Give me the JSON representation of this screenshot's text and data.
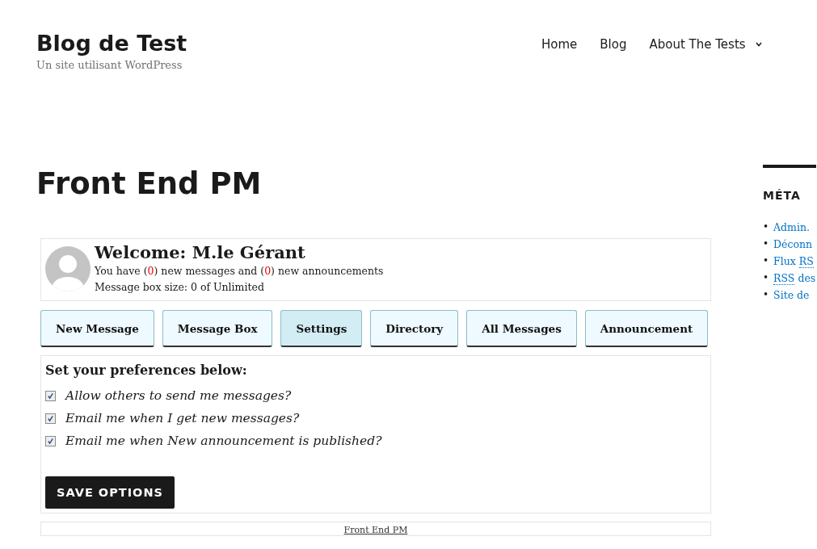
{
  "site": {
    "title": "Blog de Test",
    "tagline": "Un site utilisant WordPress"
  },
  "nav": [
    {
      "label": "Home",
      "has_caret": false
    },
    {
      "label": "Blog",
      "has_caret": false
    },
    {
      "label": "About The Tests",
      "has_caret": true
    }
  ],
  "page_title": "Front End PM",
  "welcome": {
    "title": "Welcome: M.le Gérant",
    "status_line": [
      {
        "kind": "plain",
        "text": "You have ("
      },
      {
        "kind": "count",
        "text": "0"
      },
      {
        "kind": "plain",
        "text": ") new messages and ("
      },
      {
        "kind": "count",
        "text": "0"
      },
      {
        "kind": "plain",
        "text": ") new announcements"
      }
    ],
    "box_size": "Message box size: 0 of Unlimited"
  },
  "menu": [
    {
      "label": "New Message",
      "selected": false
    },
    {
      "label": "Message Box",
      "selected": false
    },
    {
      "label": "Settings",
      "selected": true
    },
    {
      "label": "Directory",
      "selected": false
    },
    {
      "label": "All Messages",
      "selected": false
    },
    {
      "label": "Announcement",
      "selected": false
    }
  ],
  "settings": {
    "heading": "Set your preferences below:",
    "options": [
      {
        "label": "Allow others to send me messages?",
        "checked": true
      },
      {
        "label": "Email me when I get new messages?",
        "checked": true
      },
      {
        "label": "Email me when New announcement is published?",
        "checked": true
      }
    ],
    "save_button": "SAVE OPTIONS"
  },
  "footer_link": "Front End PM",
  "sidebar": {
    "heading": "MÉTA",
    "links": [
      {
        "marker": "•",
        "parts": [
          {
            "kind": "plain",
            "text": "Admin."
          }
        ]
      },
      {
        "marker": "•",
        "parts": [
          {
            "kind": "plain",
            "text": "Déconn"
          }
        ]
      },
      {
        "marker": "•",
        "parts": [
          {
            "kind": "plain",
            "text": "Flux "
          },
          {
            "kind": "abbr",
            "text": "RS"
          }
        ]
      },
      {
        "marker": "•",
        "parts": [
          {
            "kind": "abbr",
            "text": "RSS"
          },
          {
            "kind": "plain",
            "text": " des"
          }
        ]
      },
      {
        "marker": "•",
        "parts": [
          {
            "kind": "plain",
            "text": "Site de"
          }
        ]
      }
    ]
  }
}
